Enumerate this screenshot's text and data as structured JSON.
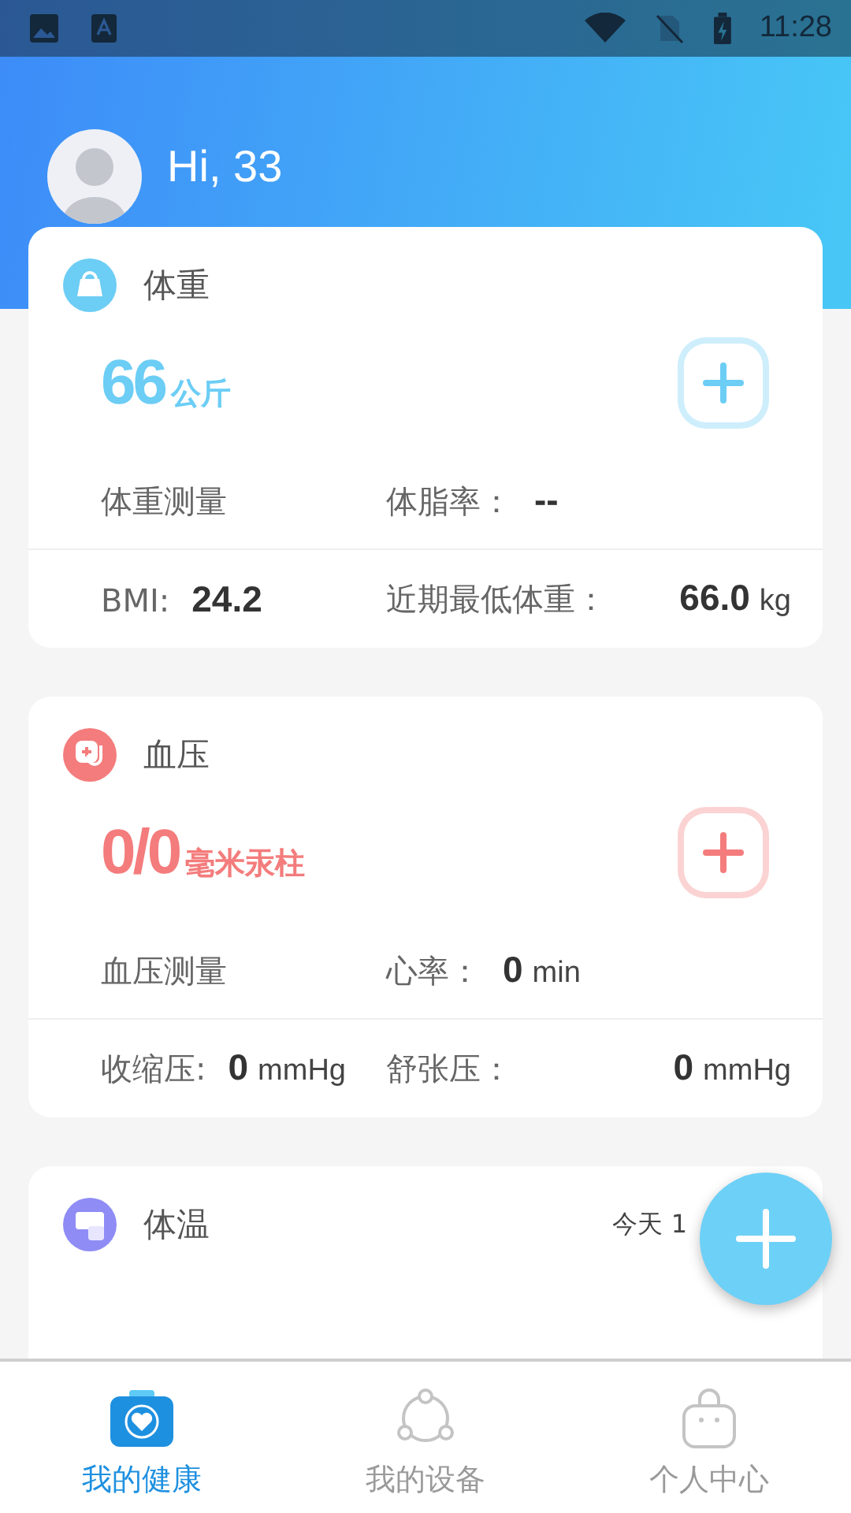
{
  "status_bar": {
    "time": "11:28"
  },
  "header": {
    "greeting": "Hi, 33"
  },
  "cards": [
    {
      "kind": "full",
      "color": "#6ccdf5",
      "title": "体重",
      "value": "66",
      "unit": "公斤",
      "measure_label": "体重测量",
      "top_stat": {
        "label": "体脂率：",
        "value": "--"
      },
      "bottom_stats": [
        {
          "label": "BMI:",
          "value": "24.2"
        },
        {
          "label": "近期最低体重：",
          "value": "66.0",
          "unit": "kg"
        }
      ]
    },
    {
      "kind": "full",
      "color": "#f47c7c",
      "title": "血压",
      "value": "0/0",
      "unit": "毫米汞柱",
      "measure_label": "血压测量",
      "top_stat": {
        "label": "心率：",
        "value": "0",
        "unit": "min"
      },
      "bottom_stats": [
        {
          "label": "收缩压:",
          "value": "0",
          "unit": "mmHg"
        },
        {
          "label": "舒张压：",
          "value": "0",
          "unit": "mmHg"
        }
      ]
    },
    {
      "kind": "partial",
      "color": "#8f8cf5",
      "title": "体温",
      "time": "今天 1"
    }
  ],
  "tabs": [
    {
      "label": "我的健康",
      "selected": true
    },
    {
      "label": "我的设备",
      "selected": false
    },
    {
      "label": "个人中心",
      "selected": false
    }
  ]
}
